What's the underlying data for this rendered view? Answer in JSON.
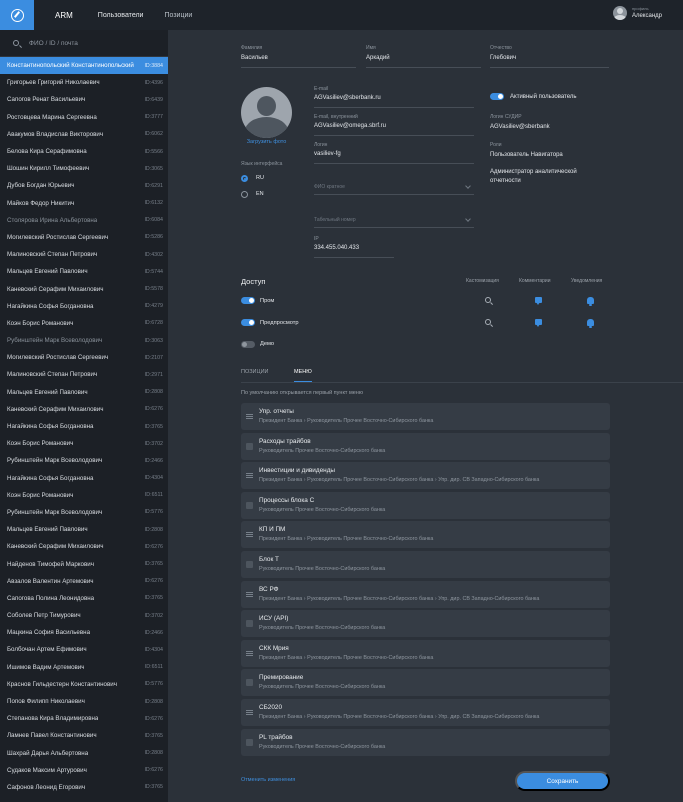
{
  "topbar": {
    "app_name": "ARM",
    "nav": [
      "Пользователи",
      "Позиции"
    ],
    "profile_label": "профиль",
    "profile_name": "Александр"
  },
  "sidebar": {
    "search_placeholder": "ФИО / ID / почта",
    "users": [
      {
        "name": "Константинопольский Константинопольский",
        "id": "ID:3884",
        "active": true
      },
      {
        "name": "Григорьев Григорий Николаевич",
        "id": "ID:4396"
      },
      {
        "name": "Сапогов Ренат Васильевич",
        "id": "ID:6439"
      },
      {
        "name": "Ростовцева Марина Сергеевна",
        "id": "ID:3777"
      },
      {
        "name": "Авакумов Владислав Викторович",
        "id": "ID:6062"
      },
      {
        "name": "Белова Кира Серафимовна",
        "id": "ID:5566"
      },
      {
        "name": "Шошин Кирилл Тимофеевич",
        "id": "ID:3065"
      },
      {
        "name": "Дубов Богдан Юрьевич",
        "id": "ID:6291"
      },
      {
        "name": "Майков Федор Никитич",
        "id": "ID:6132"
      },
      {
        "name": "Столярова Ирина Альбертовна",
        "id": "ID:6084",
        "dim": true
      },
      {
        "name": "Могилевский Ростислав Сергеевич",
        "id": "ID:5286"
      },
      {
        "name": "Малиновский Степан Петрович",
        "id": "ID:4302"
      },
      {
        "name": "Мальцев Евгений Павлович",
        "id": "ID:5744"
      },
      {
        "name": "Каневский Серафим Михаилович",
        "id": "ID:5578"
      },
      {
        "name": "Нагайкина Софья Богдановна",
        "id": "ID:4279"
      },
      {
        "name": "Коэн Борис Романович",
        "id": "ID:6728"
      },
      {
        "name": "Рубинштейн Марк Всеволодович",
        "id": "ID:3063",
        "dim": true
      },
      {
        "name": "Могилевский Ростислав Сергеевич",
        "id": "ID:2107"
      },
      {
        "name": "Малиновский Степан Петрович",
        "id": "ID:2971"
      },
      {
        "name": "Мальцев Евгений Павлович",
        "id": "ID:2808"
      },
      {
        "name": "Каневский Серафим Михаилович",
        "id": "ID:6276"
      },
      {
        "name": "Нагайкина Софья Богдановна",
        "id": "ID:3765"
      },
      {
        "name": "Коэн Борис Романович",
        "id": "ID:3702"
      },
      {
        "name": "Рубинштейн Марк Всеволодович",
        "id": "ID:2466"
      },
      {
        "name": "Нагайкина Софья Богдановна",
        "id": "ID:4304"
      },
      {
        "name": "Коэн Борис Романович",
        "id": "ID:6511"
      },
      {
        "name": "Рубинштейн Марк Всеволодович",
        "id": "ID:5776"
      },
      {
        "name": "Мальцев Евгений Павлович",
        "id": "ID:2808"
      },
      {
        "name": "Каневский Серафим Михаилович",
        "id": "ID:6276"
      },
      {
        "name": "Найденов Тимофей Маркович",
        "id": "ID:3765"
      },
      {
        "name": "Авзалов Валентин Артемович",
        "id": "ID:6276"
      },
      {
        "name": "Сапогова Полина Леонидовна",
        "id": "ID:3765"
      },
      {
        "name": "Соболев Петр Тимурович",
        "id": "ID:3702"
      },
      {
        "name": "Мацкина София Васильевна",
        "id": "ID:2466"
      },
      {
        "name": "Болбочан Артем Ефимович",
        "id": "ID:4304"
      },
      {
        "name": "Ишимов Вадим Артемович",
        "id": "ID:6511"
      },
      {
        "name": "Краснов Гильдестерн Константинович",
        "id": "ID:5776"
      },
      {
        "name": "Попов Филипп Николаевич",
        "id": "ID:2808"
      },
      {
        "name": "Степанова Кира Владимировна",
        "id": "ID:6276"
      },
      {
        "name": "Ламнев Павел Константинович",
        "id": "ID:3765"
      },
      {
        "name": "Шахрай Дарья Альбертовна",
        "id": "ID:2808"
      },
      {
        "name": "Судаков Максим Артурович",
        "id": "ID:6276"
      },
      {
        "name": "Сафонов Леонид Егорович",
        "id": "ID:3765"
      }
    ]
  },
  "profile_form": {
    "surname_label": "Фамилия",
    "surname": "Васильев",
    "name_label": "Имя",
    "name": "Аркадий",
    "patronymic_label": "Отчество",
    "patronymic": "Глебович",
    "upload_photo": "Загрузить фото",
    "language_label": "Язык интерфейса",
    "language_ru": "RU",
    "language_en": "EN",
    "email_label": "E-mail",
    "email": "AGVasiliev@sberbank.ru",
    "internal_email_label": "E-mail, внутренний",
    "internal_email": "AGVasiliev@omega.sbrf.ru",
    "login_label": "Логин",
    "login": "vasiliev-fg",
    "short_name_placeholder": "ФИО кратное",
    "tab_number_placeholder": "Табельный номер",
    "ip_label": "IP",
    "ip": "334.455.040.433",
    "active_user_label": "Активный пользователь",
    "sudir_label": "Логин СУДИР",
    "sudir": "AGVasiliev@sberbank",
    "roles_label": "Роли",
    "roles": [
      "Пользователь Навигатора",
      "Администратор аналитической отчетности"
    ]
  },
  "access": {
    "title": "Доступ",
    "columns": [
      "Кастомизация",
      "Комментарии",
      "Уведомления"
    ],
    "rows": [
      "Пром",
      "Предпросмотр",
      "Демо"
    ]
  },
  "tabs": {
    "positions": "ПОЗИЦИИ",
    "menu": "МЕНЮ"
  },
  "menu": {
    "hint": "По умолчанию открывается первый пункт меню",
    "items": [
      {
        "title": "Упр. отчеты",
        "path": "Президент Банка › Руководитель Прочее Восточно-Сибирского банка",
        "handle": true
      },
      {
        "title": "Расходы трайбов",
        "path": "Руководитель Прочее Восточно-Сибирского банка"
      },
      {
        "title": "Инвестиции и дивиденды",
        "path": "Президент Банка › Руководитель Прочее Восточно-Сибирского банка › Упр. дир. СВ Западно-Сибирского банка",
        "handle": true
      },
      {
        "title": "Процессы блока С",
        "path": "Руководитель Прочее Восточно-Сибирского банка"
      },
      {
        "title": "КП И ПМ",
        "path": "Президент Банка › Руководитель Прочее Восточно-Сибирского банка",
        "handle": true
      },
      {
        "title": "Блок Т",
        "path": "Руководитель Прочее Восточно-Сибирского банка"
      },
      {
        "title": "ВС РФ",
        "path": "Президент Банка › Руководитель Прочее Восточно-Сибирского банка › Упр. дир. СВ Западно-Сибирского банка",
        "handle": true
      },
      {
        "title": "ИСУ (API)",
        "path": "Руководитель Прочее Восточно-Сибирского банка"
      },
      {
        "title": "СКК Мрия",
        "path": "Президент Банка › Руководитель Прочее Восточно-Сибирского банка",
        "handle": true
      },
      {
        "title": "Премирование",
        "path": "Руководитель Прочее Восточно-Сибирского банка"
      },
      {
        "title": "СБ2020",
        "path": "Президент Банка › Руководитель Прочее Восточно-Сибирского банка › Упр. дир. СВ Западно-Сибирского банка",
        "handle": true
      },
      {
        "title": "PL трайбов",
        "path": "Руководитель Прочее Восточно-Сибирского банка"
      }
    ]
  },
  "actions": {
    "cancel": "Отменить изменения",
    "save": "Сохранить"
  },
  "icons": {
    "logo": "compass-icon",
    "search": "search-icon",
    "avatar": "user-avatar-icon",
    "customization": "magnifier-icon",
    "comments": "comment-icon",
    "notifications": "bell-icon",
    "drag": "drag-handle-icon"
  },
  "colors": {
    "accent": "#3b8de0",
    "sidebar_bg": "#1c2026",
    "panel_bg": "#2b3139",
    "card_bg": "#353c45"
  }
}
